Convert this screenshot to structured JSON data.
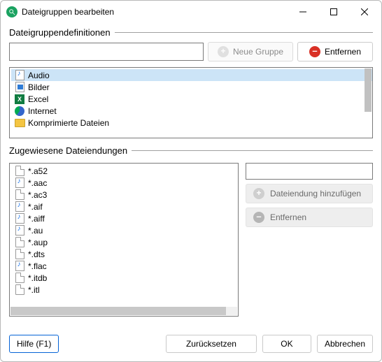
{
  "window": {
    "title": "Dateigruppen bearbeiten"
  },
  "sections": {
    "definitions": "Dateigruppendefinitionen",
    "extensions": "Zugewiesene Dateiendungen"
  },
  "buttons": {
    "new_group": "Neue Gruppe",
    "remove": "Entfernen",
    "add_ext": "Dateiendung hinzufügen",
    "remove_ext": "Entfernen",
    "help": "Hilfe (F1)",
    "reset": "Zurücksetzen",
    "ok": "OK",
    "cancel": "Abbrechen"
  },
  "inputs": {
    "group_name": "",
    "ext_name": ""
  },
  "groups": [
    {
      "label": "Audio",
      "icon": "music",
      "selected": true
    },
    {
      "label": "Bilder",
      "icon": "image",
      "selected": false
    },
    {
      "label": "Excel",
      "icon": "excel",
      "selected": false
    },
    {
      "label": "Internet",
      "icon": "edge",
      "selected": false
    },
    {
      "label": "Komprimierte Dateien",
      "icon": "zip",
      "selected": false
    }
  ],
  "extensions": [
    {
      "label": "*.a52",
      "icon": "page"
    },
    {
      "label": "*.aac",
      "icon": "music"
    },
    {
      "label": "*.ac3",
      "icon": "page"
    },
    {
      "label": "*.aif",
      "icon": "music"
    },
    {
      "label": "*.aiff",
      "icon": "music"
    },
    {
      "label": "*.au",
      "icon": "music"
    },
    {
      "label": "*.aup",
      "icon": "page"
    },
    {
      "label": "*.dts",
      "icon": "page"
    },
    {
      "label": "*.flac",
      "icon": "music"
    },
    {
      "label": "*.itdb",
      "icon": "page"
    },
    {
      "label": "*.itl",
      "icon": "page"
    }
  ]
}
